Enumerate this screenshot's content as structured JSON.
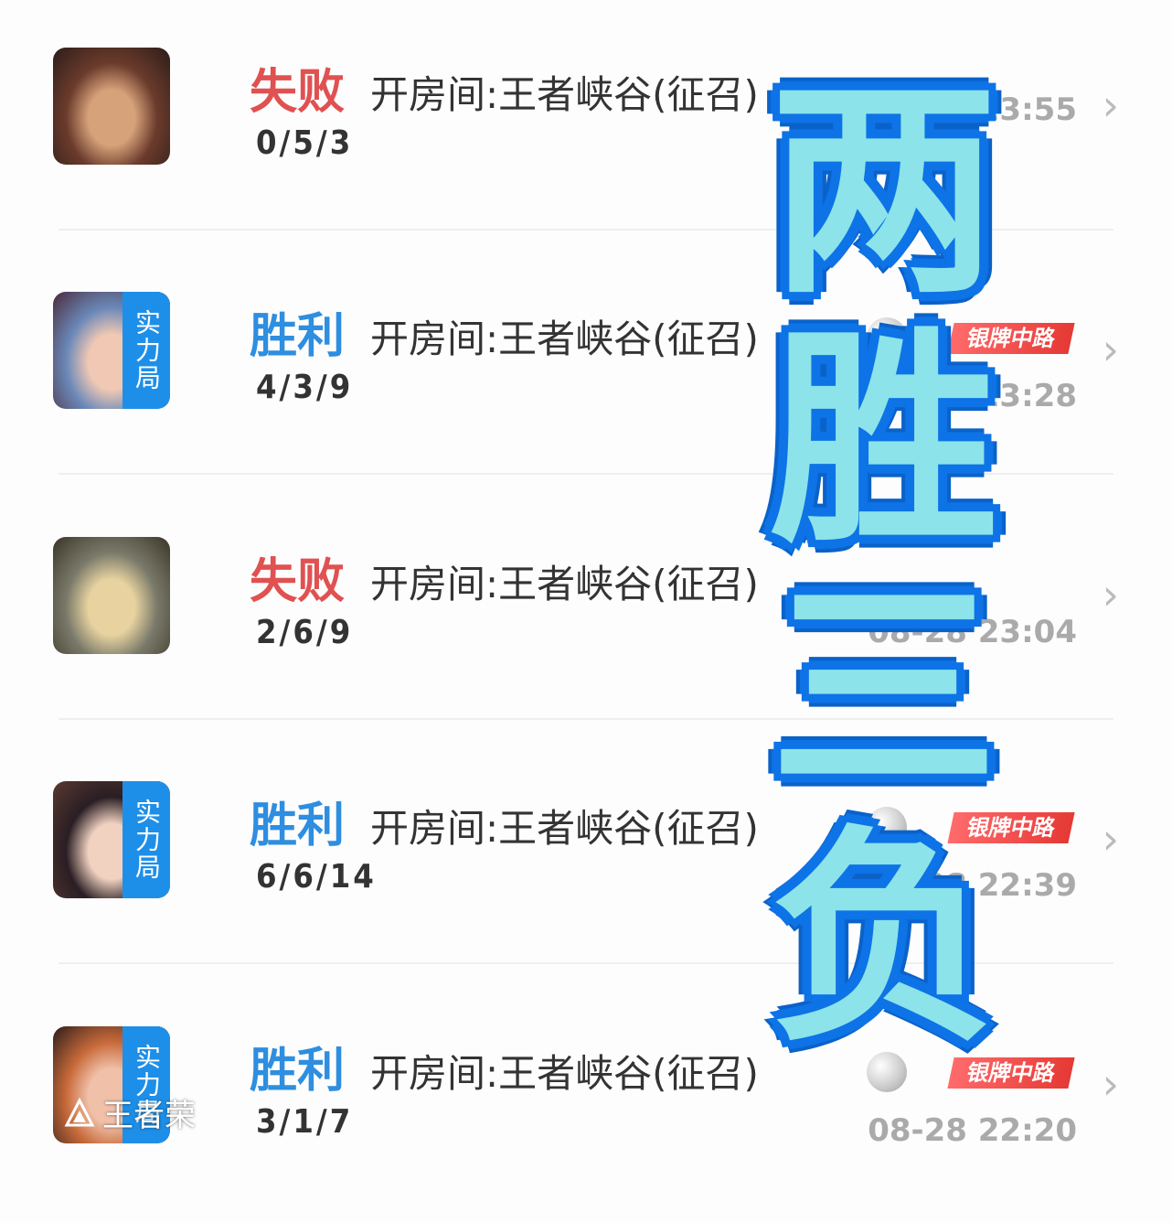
{
  "matches": [
    {
      "result": "失败",
      "result_type": "loss",
      "mode": "开房间:王者峡谷(征召)",
      "kda": "0/5/3",
      "time": "23:55",
      "badge": false,
      "rank": "",
      "avatar_colors": [
        "#6b3b2c",
        "#d6a27a",
        "#2b1c17"
      ]
    },
    {
      "result": "胜利",
      "result_type": "win",
      "mode": "开房间:王者峡谷(征召)",
      "kda": "4/3/9",
      "time": "23:28",
      "badge": true,
      "badge_text": "实力局",
      "rank": "银牌中路",
      "avatar_colors": [
        "#6a88b8",
        "#f0c8b4",
        "#4a2a3a"
      ]
    },
    {
      "result": "失败",
      "result_type": "loss",
      "mode": "开房间:王者峡谷(征召)",
      "kda": "2/6/9",
      "time": "08-28 23:04",
      "badge": false,
      "rank": "",
      "avatar_colors": [
        "#7a7a6a",
        "#e8d3a0",
        "#3a3426"
      ]
    },
    {
      "result": "胜利",
      "result_type": "win",
      "mode": "开房间:王者峡谷(征召)",
      "kda": "6/6/14",
      "time": "-28 22:39",
      "badge": true,
      "badge_text": "实力局",
      "rank": "银牌中路",
      "avatar_colors": [
        "#2a1e24",
        "#f1d2c0",
        "#5a3a30"
      ]
    },
    {
      "result": "胜利",
      "result_type": "win",
      "mode": "开房间:王者峡谷(征召)",
      "kda": "3/1/7",
      "time": "08-28 22:20",
      "badge": true,
      "badge_text": "实力局",
      "rank": "银牌中路",
      "avatar_colors": [
        "#c86a3a",
        "#f0c0a8",
        "#2a1c1a"
      ]
    }
  ],
  "overlay_text": [
    "两",
    "胜",
    "三",
    "负"
  ],
  "watermark": "王者荣",
  "chevron": "›"
}
